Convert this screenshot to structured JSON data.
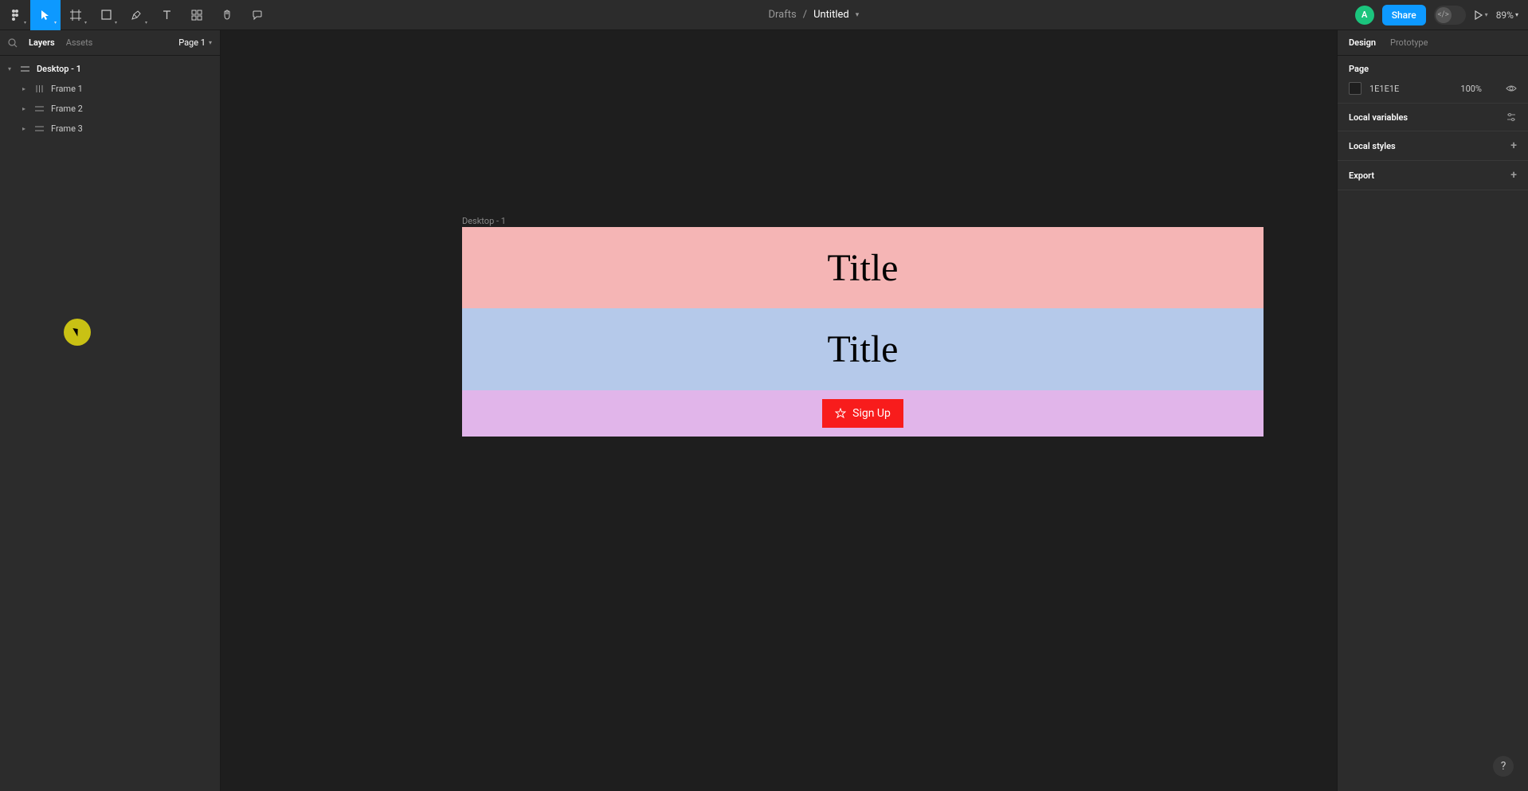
{
  "toolbar": {
    "breadcrumb_root": "Drafts",
    "breadcrumb_sep": "/",
    "title": "Untitled",
    "avatar_initial": "A",
    "share_label": "Share",
    "zoom": "89%"
  },
  "left_panel": {
    "tab_layers": "Layers",
    "tab_assets": "Assets",
    "page_selector": "Page 1",
    "layers": {
      "root": "Desktop - 1",
      "children": [
        "Frame 1",
        "Frame 2",
        "Frame 3"
      ]
    }
  },
  "right_panel": {
    "tab_design": "Design",
    "tab_prototype": "Prototype",
    "page_section": "Page",
    "page_color": "1E1E1E",
    "page_opacity": "100%",
    "local_variables": "Local variables",
    "local_styles": "Local styles",
    "export": "Export"
  },
  "canvas": {
    "frame_label": "Desktop - 1",
    "title1": "Title",
    "title2": "Title",
    "signup": "Sign Up"
  },
  "help": "?"
}
